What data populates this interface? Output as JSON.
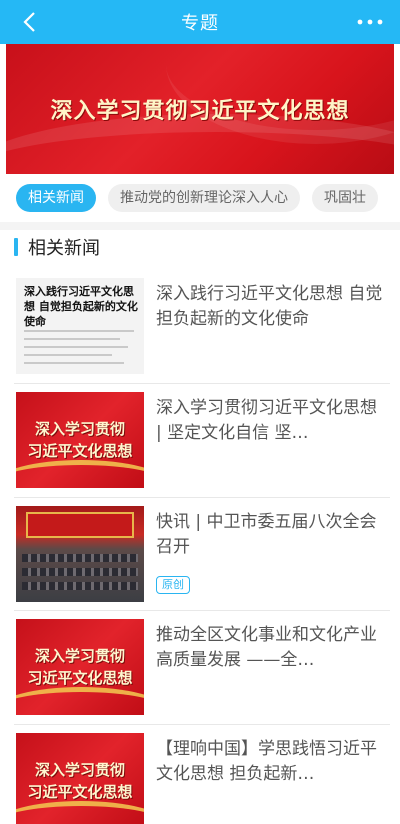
{
  "header": {
    "title": "专题"
  },
  "banner": {
    "text": "深入学习贯彻习近平文化思想"
  },
  "tabs": [
    {
      "label": "相关新闻",
      "active": true
    },
    {
      "label": "推动党的创新理论深入人心",
      "active": false
    },
    {
      "label": "巩固壮",
      "active": false
    }
  ],
  "section": {
    "title": "相关新闻"
  },
  "news": [
    {
      "title": "深入践行习近平文化思想 自觉担负起新的文化使命",
      "thumb_text": "深入践行习近平文化思想 自觉担负起新的文化使命"
    },
    {
      "title": "深入学习贯彻习近平文化思想 | 坚定文化自信 坚…",
      "thumb_text_1": "深入学习贯彻",
      "thumb_text_2": "习近平文化思想"
    },
    {
      "title": "快讯 | 中卫市委五届八次全会召开",
      "badge": "原创"
    },
    {
      "title": "推动全区文化事业和文化产业高质量发展 ——全…",
      "thumb_text_1": "深入学习贯彻",
      "thumb_text_2": "习近平文化思想"
    },
    {
      "title": "【理响中国】学思践悟习近平文化思想 担负起新…",
      "thumb_text_1": "深入学习贯彻",
      "thumb_text_2": "习近平文化思想"
    }
  ],
  "colors": {
    "header": "#25b8f5",
    "accent": "#2ab5f1",
    "banner_red": "#e32129"
  },
  "icons": {
    "back": "chevron-left-icon",
    "more": "more-dots-icon"
  }
}
